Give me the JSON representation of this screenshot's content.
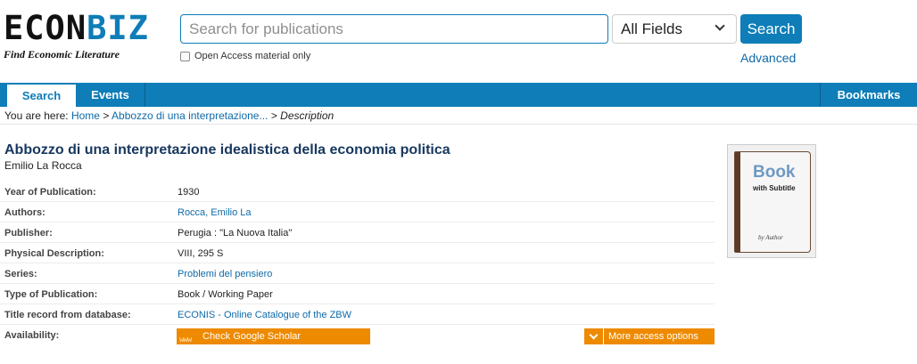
{
  "header": {
    "logo_main": "ECON",
    "logo_accent": "BIZ",
    "logo_tagline": "Find Economic Literature",
    "search_placeholder": "Search for publications",
    "field_select": "All Fields",
    "search_button": "Search",
    "open_access_label": "Open Access material only",
    "advanced_link": "Advanced"
  },
  "nav": {
    "search": "Search",
    "events": "Events",
    "bookmarks": "Bookmarks"
  },
  "breadcrumb": {
    "prefix": "You are here:",
    "home": "Home",
    "sep1": ">",
    "record": "Abbozzo di una interpretazione...",
    "sep2": ">",
    "current": "Description"
  },
  "record": {
    "title": "Abbozzo di una interpretazione idealistica della economia politica",
    "author": "Emilio La Rocca",
    "details": [
      {
        "label": "Year of Publication:",
        "value": "1930"
      },
      {
        "label": "Authors:",
        "value": "Rocca, Emilio La"
      },
      {
        "label": "Publisher:",
        "value": "Perugia : \"La Nuova Italia\""
      },
      {
        "label": "Physical Description:",
        "value": "VIII, 295 S"
      },
      {
        "label": "Series:",
        "value": "Problemi del pensiero"
      },
      {
        "label": "Type of Publication:",
        "value": "Book / Working Paper"
      },
      {
        "label": "Title record from database:",
        "value": "ECONIS - Online Catalogue of the ZBW"
      }
    ],
    "availability": {
      "label": "Availability:",
      "scholar_icon": "www",
      "scholar_button": "Check Google Scholar",
      "more_button": "More access options"
    }
  },
  "cover": {
    "title": "Book",
    "subtitle": "with Subtitle",
    "by": "by Author"
  },
  "colors": {
    "brand_blue": "#0e7db8",
    "action_orange": "#ee8a00",
    "link_blue": "#0e6aa8"
  }
}
